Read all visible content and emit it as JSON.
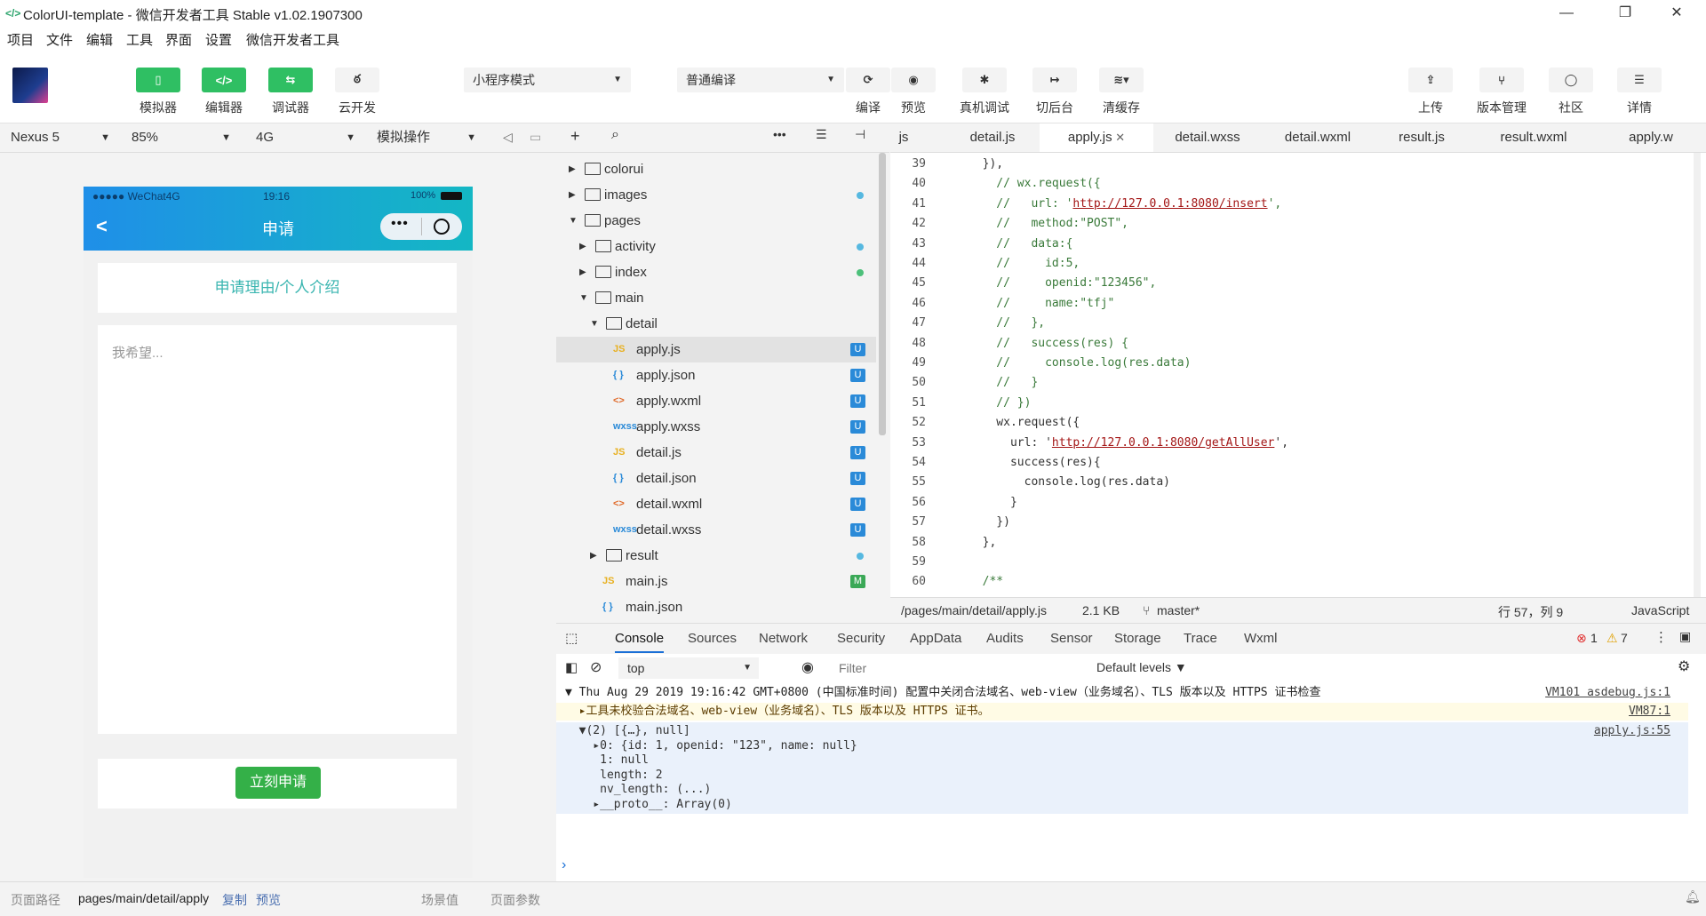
{
  "window": {
    "title": "ColorUI-template - 微信开发者工具 Stable v1.02.1907300",
    "minimize": "—",
    "restore": "❐",
    "close": "✕"
  },
  "menu": [
    "项目",
    "文件",
    "编辑",
    "工具",
    "界面",
    "设置",
    "微信开发者工具"
  ],
  "toolbar": {
    "simulator": "模拟器",
    "editor": "编辑器",
    "debugger": "调试器",
    "cloud": "云开发",
    "mode": "小程序模式",
    "compile_mode": "普通编译",
    "compile": "编译",
    "preview": "预览",
    "remote_debug": "真机调试",
    "background": "切后台",
    "clear_cache": "清缓存",
    "upload": "上传",
    "version": "版本管理",
    "community": "社区",
    "details": "详情"
  },
  "simbar": {
    "device": "Nexus 5",
    "zoom": "85%",
    "network": "4G",
    "operation": "模拟操作"
  },
  "phone": {
    "carrier": "●●●●● WeChat4G",
    "time": "19:16",
    "battery": "100%",
    "nav_title": "申请",
    "back": "<",
    "card_title": "申请理由/个人介绍",
    "textarea_placeholder": "我希望...",
    "submit": "立刻申请"
  },
  "bottombar": {
    "path_label": "页面路径",
    "path": "pages/main/detail/apply",
    "copy": "复制",
    "preview": "预览",
    "scene": "场景值",
    "params": "页面参数"
  },
  "tree": [
    {
      "name": "colorui",
      "type": "folder",
      "depth": 0,
      "open": false,
      "mark": ""
    },
    {
      "name": "images",
      "type": "folder",
      "depth": 0,
      "open": false,
      "mark": "dot-blue"
    },
    {
      "name": "pages",
      "type": "folder",
      "depth": 0,
      "open": true,
      "mark": ""
    },
    {
      "name": "activity",
      "type": "folder",
      "depth": 1,
      "open": false,
      "mark": "dot-blue"
    },
    {
      "name": "index",
      "type": "folder",
      "depth": 1,
      "open": false,
      "mark": "dot-green"
    },
    {
      "name": "main",
      "type": "folder",
      "depth": 1,
      "open": true,
      "mark": ""
    },
    {
      "name": "detail",
      "type": "folder",
      "depth": 2,
      "open": true,
      "mark": ""
    },
    {
      "name": "apply.js",
      "type": "js",
      "depth": 3,
      "mark": "U",
      "selected": true
    },
    {
      "name": "apply.json",
      "type": "json",
      "depth": 3,
      "mark": "U"
    },
    {
      "name": "apply.wxml",
      "type": "wxml",
      "depth": 3,
      "mark": "U"
    },
    {
      "name": "apply.wxss",
      "type": "wxss",
      "depth": 3,
      "mark": "U"
    },
    {
      "name": "detail.js",
      "type": "js",
      "depth": 3,
      "mark": "U"
    },
    {
      "name": "detail.json",
      "type": "json",
      "depth": 3,
      "mark": "U"
    },
    {
      "name": "detail.wxml",
      "type": "wxml",
      "depth": 3,
      "mark": "U"
    },
    {
      "name": "detail.wxss",
      "type": "wxss",
      "depth": 3,
      "mark": "U"
    },
    {
      "name": "result",
      "type": "folder",
      "depth": 2,
      "open": false,
      "mark": "dot-blue"
    },
    {
      "name": "main.js",
      "type": "js",
      "depth": 2,
      "mark": "M"
    },
    {
      "name": "main.json",
      "type": "json",
      "depth": 2,
      "mark": ""
    }
  ],
  "tabs": [
    {
      "label": "js",
      "active": false
    },
    {
      "label": "detail.js",
      "active": false
    },
    {
      "label": "apply.js",
      "active": true
    },
    {
      "label": "detail.wxss",
      "active": false
    },
    {
      "label": "detail.wxml",
      "active": false
    },
    {
      "label": "result.js",
      "active": false
    },
    {
      "label": "result.wxml",
      "active": false
    },
    {
      "label": "apply.w",
      "active": false
    }
  ],
  "code": [
    {
      "n": "39",
      "t": "  }),"
    },
    {
      "n": "40",
      "t": "    // wx.request({"
    },
    {
      "n": "41",
      "t": "    //   url: 'http://127.0.0.1:8080/insert',"
    },
    {
      "n": "42",
      "t": "    //   method:\"POST\","
    },
    {
      "n": "43",
      "t": "    //   data:{"
    },
    {
      "n": "44",
      "t": "    //     id:5,"
    },
    {
      "n": "45",
      "t": "    //     openid:\"123456\","
    },
    {
      "n": "46",
      "t": "    //     name:\"tfj\""
    },
    {
      "n": "47",
      "t": "    //   },"
    },
    {
      "n": "48",
      "t": "    //   success(res) {"
    },
    {
      "n": "49",
      "t": "    //     console.log(res.data)"
    },
    {
      "n": "50",
      "t": "    //   }"
    },
    {
      "n": "51",
      "t": "    // })"
    },
    {
      "n": "52",
      "t": "    wx.request({"
    },
    {
      "n": "53",
      "t": "      url: 'http://127.0.0.1:8080/getAllUser',"
    },
    {
      "n": "54",
      "t": "      success(res){"
    },
    {
      "n": "55",
      "t": "        console.log(res.data)"
    },
    {
      "n": "56",
      "t": "      }"
    },
    {
      "n": "57",
      "t": "    })"
    },
    {
      "n": "58",
      "t": "  },"
    },
    {
      "n": "59",
      "t": ""
    },
    {
      "n": "60",
      "t": "  /**"
    }
  ],
  "statusline": {
    "path": "/pages/main/detail/apply.js",
    "size": "2.1 KB",
    "branch": "master*",
    "position": "行 57，列 9",
    "language": "JavaScript"
  },
  "devtools": {
    "tabs": [
      "Console",
      "Sources",
      "Network",
      "Security",
      "AppData",
      "Audits",
      "Sensor",
      "Storage",
      "Trace",
      "Wxml"
    ],
    "errors": "1",
    "warnings": "7",
    "context": "top",
    "filter_placeholder": "Filter",
    "levels": "Default levels ▼"
  },
  "console": [
    {
      "text": "▼ Thu Aug 29 2019 19:16:42 GMT+0800 (中国标准时间) 配置中关闭合法域名、web-view（业务域名）、TLS 版本以及 HTTPS 证书检查",
      "src": "VM101 asdebug.js:1",
      "kind": "group"
    },
    {
      "text": "  ▸工具未校验合法域名、web-view（业务域名）、TLS 版本以及 HTTPS 证书。",
      "src": "VM87:1",
      "kind": "warn"
    },
    {
      "text": "  ▼(2) [{…}, null]",
      "src": "apply.js:55",
      "kind": "log"
    },
    {
      "text": "    ▸0: {id: 1, openid: \"123\", name: null}",
      "src": "",
      "kind": "log"
    },
    {
      "text": "     1: null",
      "src": "",
      "kind": "log"
    },
    {
      "text": "     length: 2",
      "src": "",
      "kind": "log"
    },
    {
      "text": "     nv_length: (...)",
      "src": "",
      "kind": "log"
    },
    {
      "text": "    ▸__proto__: Array(0)",
      "src": "",
      "kind": "log"
    }
  ],
  "colors": {
    "accent_green": "#2fbf63",
    "nav_blue": "#1f8fe8",
    "nav_cyan": "#14b7c4",
    "teal_text": "#39b5b0"
  }
}
